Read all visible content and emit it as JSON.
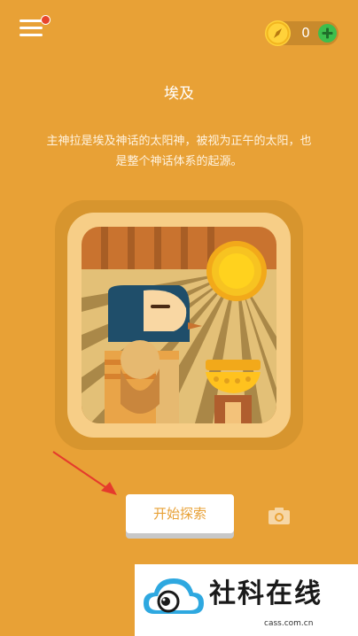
{
  "header": {
    "menu_icon": "hamburger-menu-icon",
    "notification_dot_color": "#E8452C",
    "coins": {
      "count": "0",
      "coin_icon": "compass-coin-icon",
      "add_icon": "plus-circle-icon"
    }
  },
  "topic": {
    "title": "埃及",
    "description": "主神拉是埃及神话的太阳神，被视为正午的太阳，也是整个神话体系的起源。"
  },
  "actions": {
    "start_label": "开始探索",
    "camera_icon": "camera-icon"
  },
  "watermark": {
    "brand": "社科在线",
    "url": "cass.com.cn"
  },
  "colors": {
    "background": "#E8A136",
    "accent": "#E8A136",
    "add_green": "#3DBE4D",
    "arrow_red": "#E53B2C"
  }
}
